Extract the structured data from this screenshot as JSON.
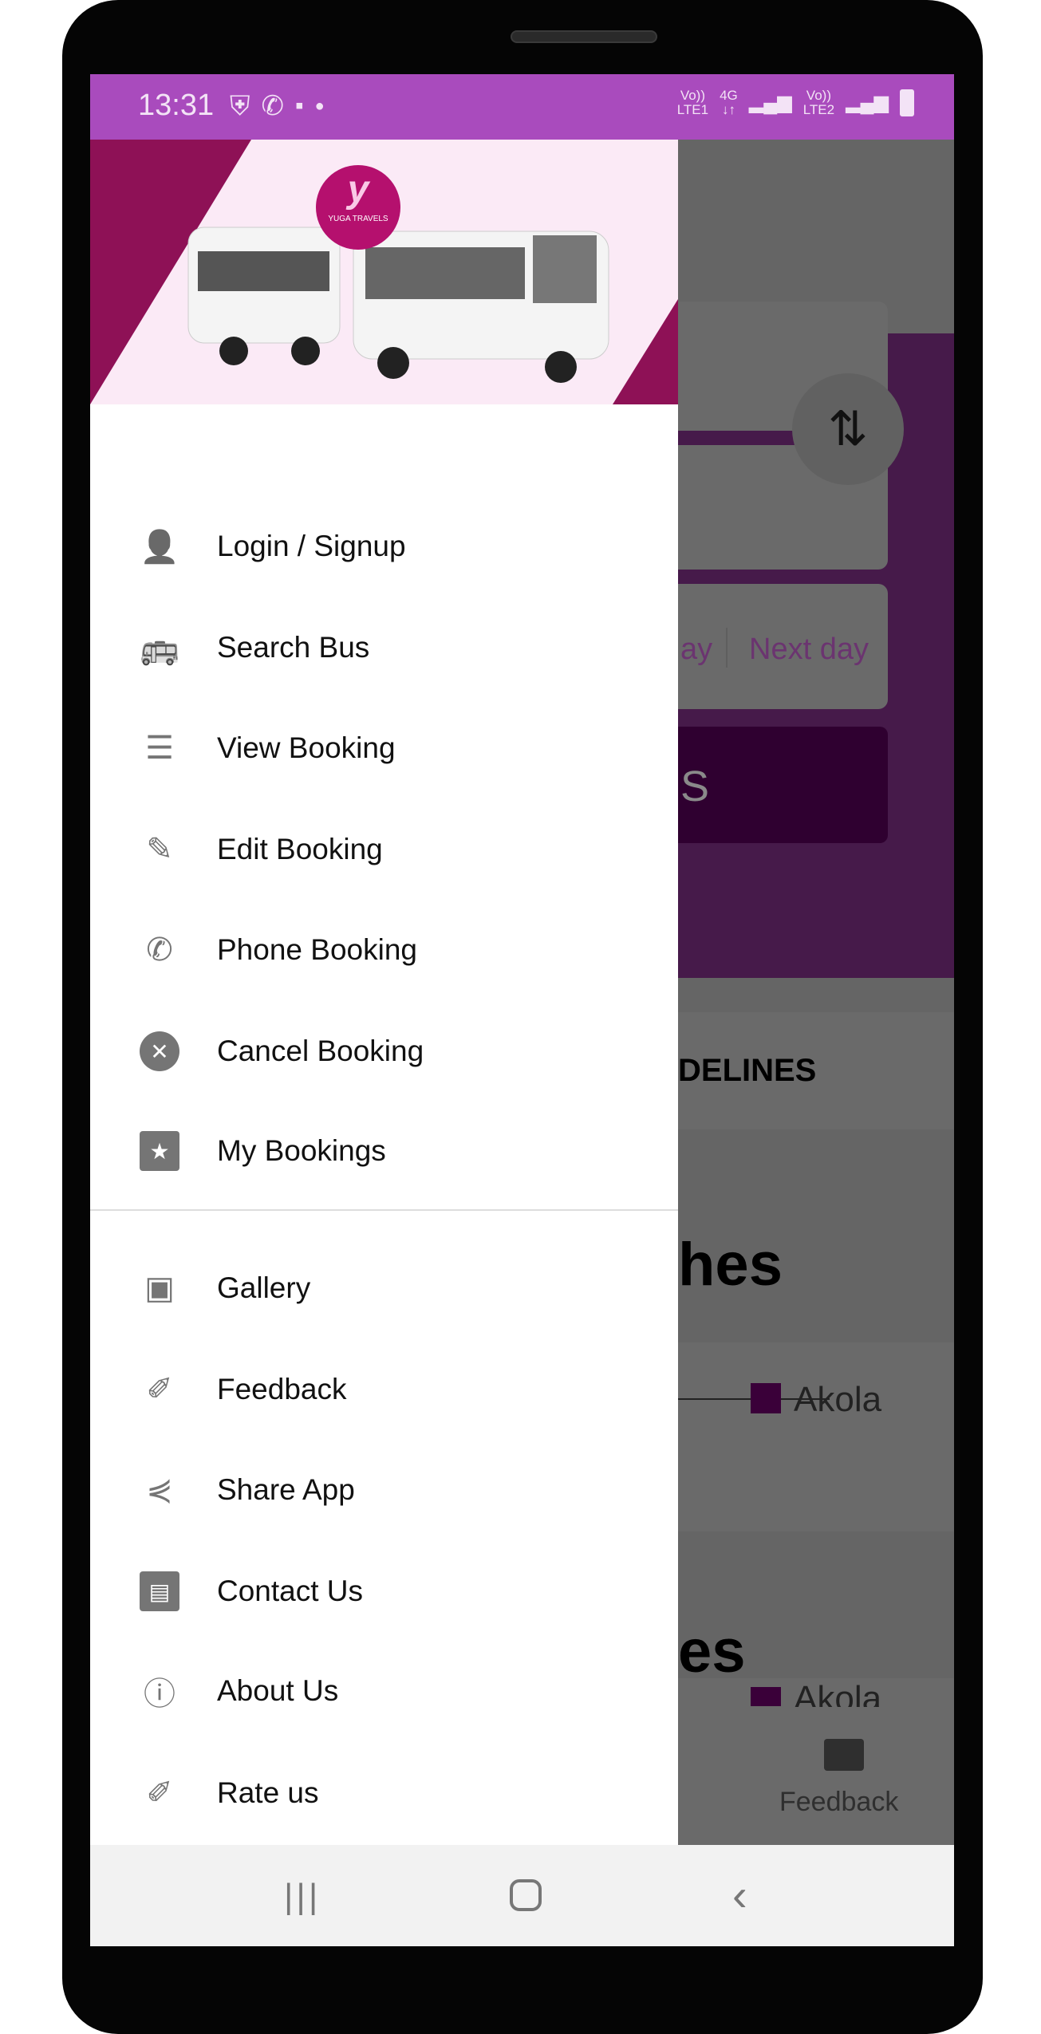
{
  "status_bar": {
    "time": "13:31",
    "icons": [
      "shield-check-icon",
      "whatsapp-icon",
      "message-icon",
      "dot-icon"
    ],
    "sim1": {
      "volte": "Vo))",
      "network": "LTE1",
      "type": "4G"
    },
    "sim2": {
      "volte": "Vo))",
      "network": "LTE2"
    },
    "color": "#a94bbd"
  },
  "drawer": {
    "logo_text": "YUGA TRAVELS",
    "brand_color": "#8e1156",
    "primary_items": [
      {
        "label": "Login / Signup",
        "icon": "person-icon"
      },
      {
        "label": "Search Bus",
        "icon": "bus-icon"
      },
      {
        "label": "View Booking",
        "icon": "receipt-icon"
      },
      {
        "label": "Edit Booking",
        "icon": "pencil-icon"
      },
      {
        "label": "Phone Booking",
        "icon": "phone-icon"
      },
      {
        "label": "Cancel Booking",
        "icon": "cancel-icon"
      },
      {
        "label": "My Bookings",
        "icon": "ticket-star-icon"
      }
    ],
    "secondary_items": [
      {
        "label": "Gallery",
        "icon": "gallery-icon"
      },
      {
        "label": "Feedback",
        "icon": "feedback-icon"
      },
      {
        "label": "Share App",
        "icon": "share-icon"
      },
      {
        "label": "Contact Us",
        "icon": "contact-icon"
      },
      {
        "label": "About Us",
        "icon": "info-icon"
      },
      {
        "label": "Rate us",
        "icon": "rate-icon"
      }
    ]
  },
  "background": {
    "date_fragment": "ay",
    "next_day": "Next day",
    "search_fragment": "S",
    "guidelines_fragment": "DELINES",
    "heading1_fragment": "hes",
    "route_city": "Akola",
    "heading2_fragment": "es",
    "route_city2": "Akola",
    "bottom_nav_feedback": "Feedback"
  }
}
